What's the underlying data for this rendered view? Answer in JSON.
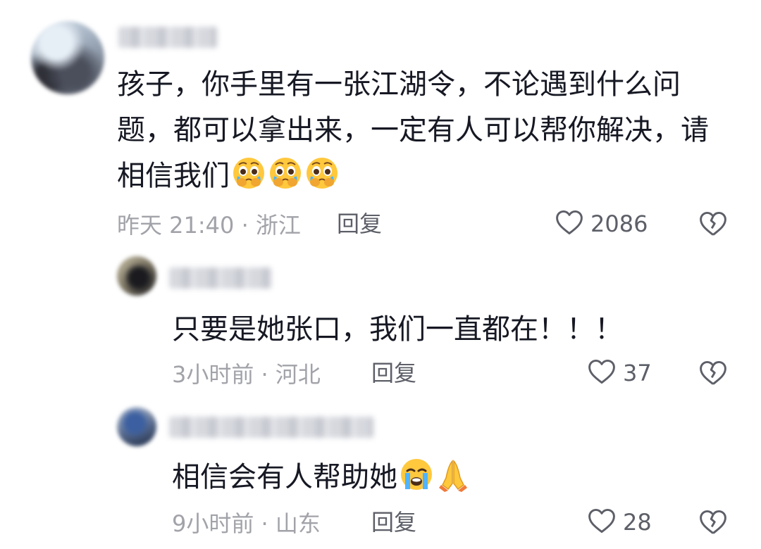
{
  "comments": [
    {
      "username": "",
      "text": "孩子，你手里有一张江湖令，不论遇到什么问题，都可以拿出来，一定有人可以帮你解决，请相信我们",
      "emojis": [
        "pleading-face-crying-emoji",
        "pleading-face-crying-emoji",
        "pleading-face-crying-emoji"
      ],
      "meta": "昨天 21:40 · 浙江",
      "reply_label": "回复",
      "likes": "2086"
    },
    {
      "username": "",
      "text": "只要是她张口，我们一直都在！！！",
      "emojis": [],
      "meta": "3小时前 · 河北",
      "reply_label": "回复",
      "likes": "37"
    },
    {
      "username": "",
      "text": "相信会有人帮助她",
      "emojis": [
        "loudly-crying-face-emoji",
        "folded-hands-emoji"
      ],
      "meta": "9小时前 · 山东",
      "reply_label": "回复",
      "likes": "28"
    }
  ],
  "icons": {
    "like": "heart-outline-icon",
    "dislike": "broken-heart-icon"
  },
  "colors": {
    "text": "#161823",
    "meta": "#a2a3a9",
    "action": "#5d5f68",
    "emoji_yellow": "#ffc83d"
  }
}
